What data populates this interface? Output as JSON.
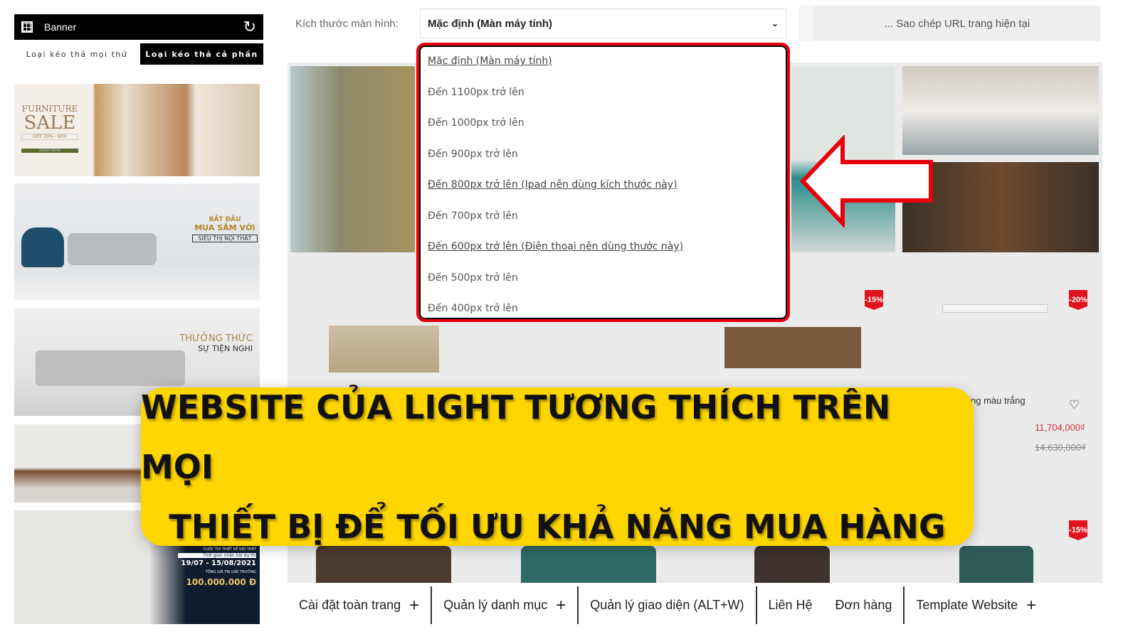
{
  "panel": {
    "title": "Banner",
    "icon": "grid-icon",
    "refresh_icon": "refresh-icon",
    "tabs": [
      "Loại kéo thả mọi thứ",
      "Loại kéo thả cả phần"
    ],
    "active_tab": 1
  },
  "banners": [
    {
      "l1": "FURNITURE",
      "l2": "SALE",
      "l3": "OFF 20% - 40%",
      "l4": "SHOP NOW"
    },
    {
      "l1": "BẮT ĐẦU",
      "l2": "MUA SẮM VỚI",
      "l3": "SIÊU THỊ NỘI THẤT"
    },
    {
      "l1": "THƯỞNG THỨC",
      "l2": "SỰ TIỆN NGHI"
    },
    {},
    {
      "l1": "CUỘC THI THIẾT KẾ NỘI THẤT",
      "l2": "Thời gian nhận bài dự thi",
      "l3": "19/07 - 15/08/2021",
      "l4": "TỔNG GIÁ TRỊ GIẢI THƯỞNG",
      "l5": "100.000.000 Đ"
    }
  ],
  "toolbar": {
    "screen_label": "Kích thước màn hình:",
    "screen_value": "Mặc định (Màn máy tính)",
    "copy_url": "... Sao chép URL trang hiện tại"
  },
  "dropdown": {
    "options": [
      "Mặc định (Màn máy tính)",
      "Đến 1100px trở lên",
      "Đến 1000px trở lên",
      "Đến 900px trở lên",
      "Đến 800px trở lên (Ipad nên dùng kích thước này)",
      "Đến 700px trở lên",
      "Đến 600px trở lên (Điện thoại nên dùng thước này)",
      "Đến 500px trở lên",
      "Đến 400px trở lên"
    ]
  },
  "products": {
    "badges": [
      "-15%",
      "-20%",
      "-15%"
    ],
    "name": "ng màu trắng",
    "price": "11,704,000₫",
    "old_price": "14,630,000₫"
  },
  "headline": {
    "line1": "WEBSITE CỦA LIGHT TƯƠNG THÍCH TRÊN MỌI",
    "line2": "THIẾT BỊ ĐỂ TỐI ƯU KHẢ NĂNG MUA HÀNG"
  },
  "nav": [
    "Cài đặt toàn trang",
    "Quản lý danh mục",
    "Quản lý giao diện (ALT+W)",
    "Liên Hệ",
    "Đơn hàng",
    "Template Website"
  ],
  "colors": {
    "highlight": "#e8000b",
    "banner": "#ffd600",
    "badge": "#e0141c",
    "price": "#d32f2f"
  }
}
